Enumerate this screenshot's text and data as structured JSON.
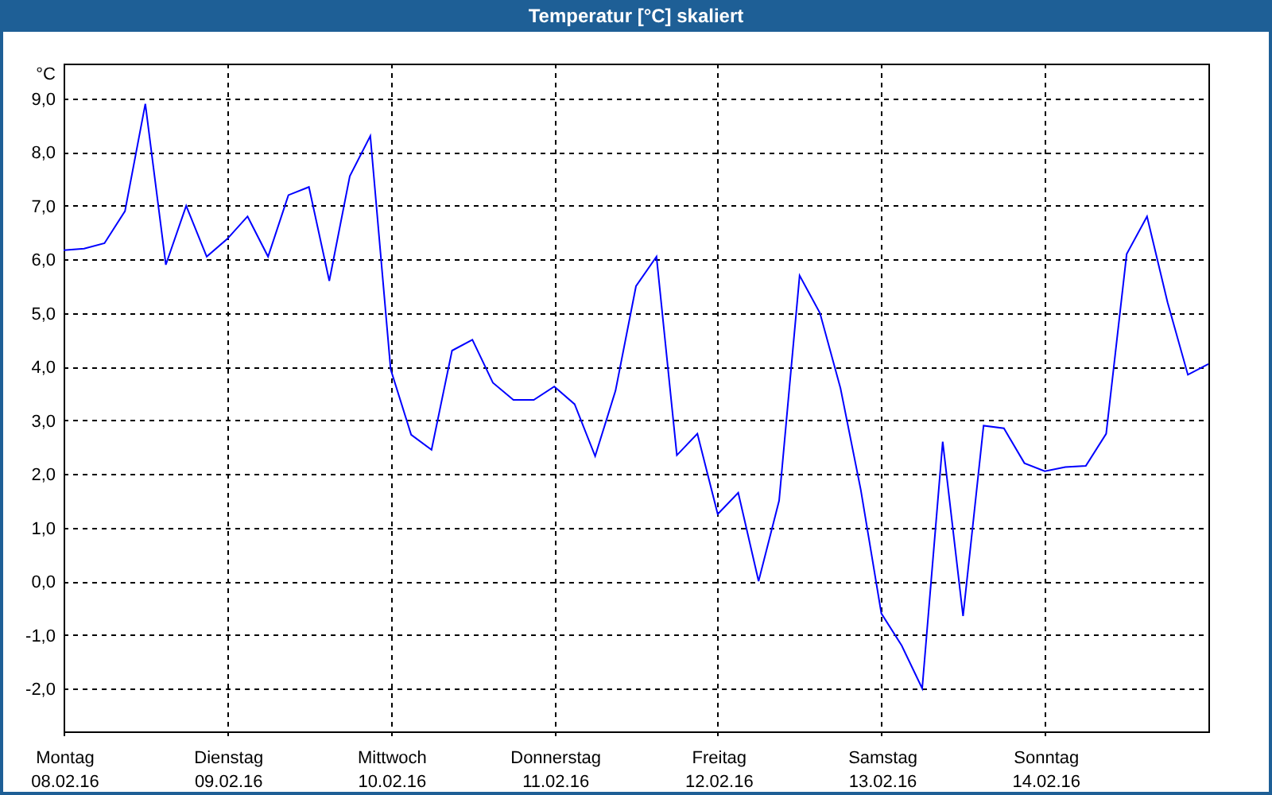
{
  "window": {
    "title": "Temperatur [°C] skaliert"
  },
  "chart_data": {
    "type": "line",
    "ylabel": "°C",
    "categories": [
      "Montag\n08.02.16",
      null,
      null,
      null,
      null,
      null,
      null,
      null,
      "Dienstag\n09.02.16",
      null,
      null,
      null,
      null,
      null,
      null,
      null,
      "Mittwoch\n10.02.16",
      null,
      null,
      null,
      null,
      null,
      null,
      null,
      "Donnerstag\n11.02.16",
      null,
      null,
      null,
      null,
      null,
      null,
      null,
      "Freitag\n12.02.16",
      null,
      null,
      null,
      null,
      null,
      null,
      null,
      "Samstag\n13.02.16",
      null,
      null,
      null,
      null,
      null,
      null,
      null,
      "Sonntag\n14.02.16",
      null,
      null,
      null,
      null,
      null,
      null,
      null,
      null
    ],
    "series": [
      {
        "color": "#0000ff",
        "values": [
          6.17,
          6.2,
          6.3,
          6.9,
          8.9,
          5.9,
          7.0,
          6.05,
          6.38,
          6.8,
          6.05,
          7.2,
          7.35,
          5.6,
          7.55,
          8.3,
          3.95,
          2.73,
          2.45,
          4.3,
          4.5,
          3.7,
          3.38,
          3.38,
          3.63,
          3.3,
          2.33,
          3.55,
          5.5,
          6.05,
          2.35,
          2.75,
          1.25,
          1.65,
          0.0,
          1.5,
          5.7,
          5.0,
          3.6,
          1.7,
          -0.6,
          -1.2,
          -2.0,
          2.6,
          -0.65,
          2.9,
          2.85,
          2.2,
          2.05,
          2.13,
          2.15,
          2.75,
          6.1,
          6.8,
          5.2,
          3.85,
          4.05
        ]
      }
    ],
    "ylim": [
      -2.8,
      9.65
    ],
    "grid": true,
    "yticks": [
      {
        "value": -2,
        "label": "-2,0"
      },
      {
        "value": -1,
        "label": "-1,0"
      },
      {
        "value": 0,
        "label": "0,0"
      },
      {
        "value": 1,
        "label": "1,0"
      },
      {
        "value": 2,
        "label": "2,0"
      },
      {
        "value": 3,
        "label": "3,0"
      },
      {
        "value": 4,
        "label": "4,0"
      },
      {
        "value": 5,
        "label": "5,0"
      },
      {
        "value": 6,
        "label": "6,0"
      },
      {
        "value": 7,
        "label": "7,0"
      },
      {
        "value": 8,
        "label": "8,0"
      },
      {
        "value": 9,
        "label": "9,0"
      }
    ]
  }
}
